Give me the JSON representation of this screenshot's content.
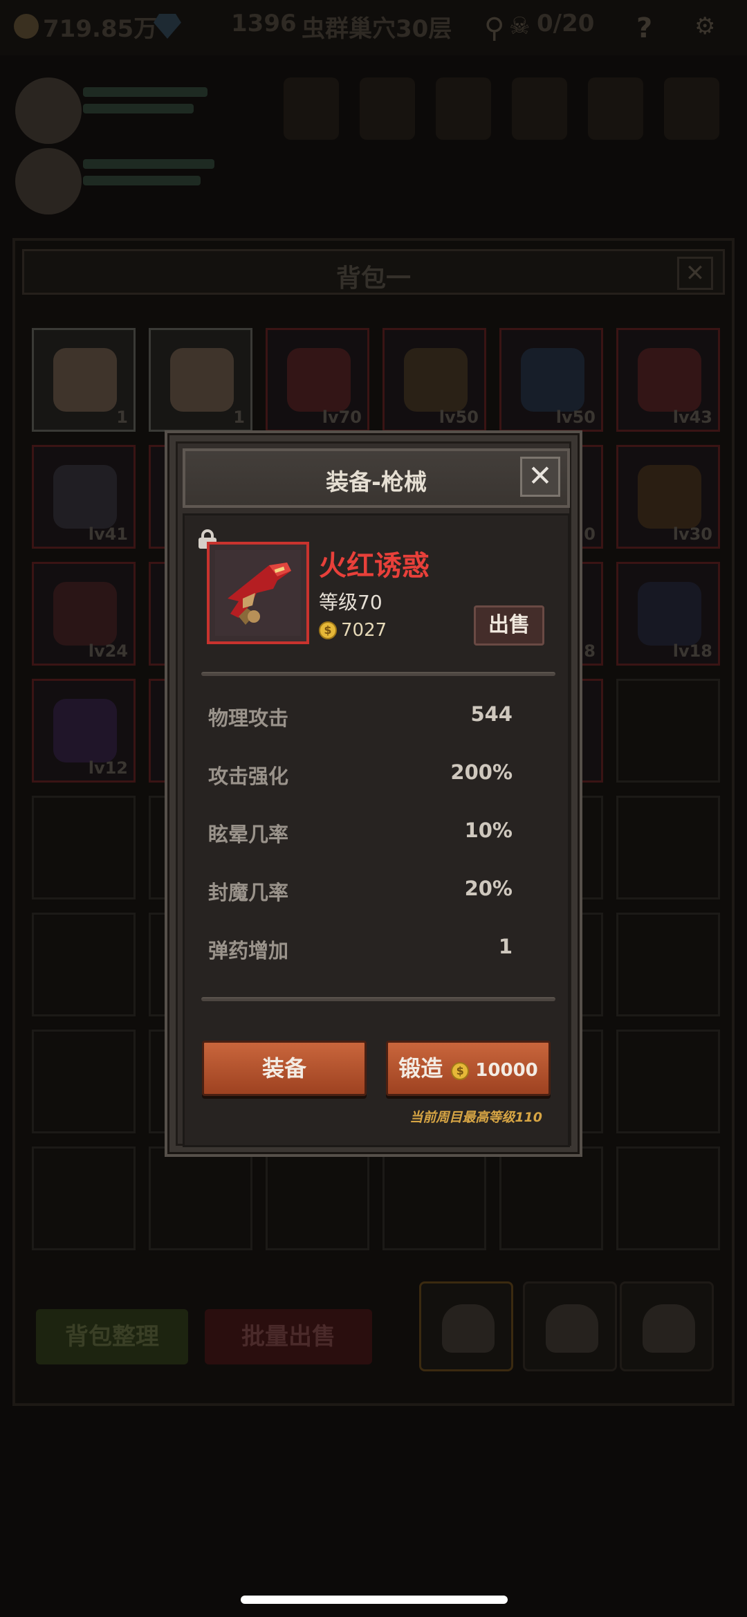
{
  "top_bar": {
    "gold": "719.85万",
    "score": "1396",
    "location": "虫群巢穴30层",
    "keys": "0/20",
    "help_icon": "?"
  },
  "background_panel": {
    "title": "背包一",
    "close_label": "✕",
    "grid_levels": [
      "1",
      "1",
      "lv70",
      "lv50",
      "lv50",
      "lv43",
      "lv41",
      "",
      "",
      "",
      "0",
      "lv30",
      "lv24",
      "",
      "",
      "",
      "8",
      "lv18",
      "lv12"
    ],
    "sort_button": "背包整理",
    "bulk_sell_button": "批量出售"
  },
  "modal": {
    "title": "装备-枪械",
    "close_label": "✕",
    "item": {
      "name": "火红诱惑",
      "level_text": "等级70",
      "coin_symbol": "$",
      "price": "7027",
      "locked": true
    },
    "sell_button": "出售",
    "stats": [
      {
        "label": "物理攻击",
        "value": "544"
      },
      {
        "label": "攻击强化",
        "value": "200%"
      },
      {
        "label": "眩晕几率",
        "value": "10%"
      },
      {
        "label": "封魔几率",
        "value": "20%"
      },
      {
        "label": "弹药增加",
        "value": "1"
      }
    ],
    "equip_button": "装备",
    "forge_button": "锻造",
    "forge_cost": "10000",
    "forge_note": "当前周目最高等级110"
  },
  "colors": {
    "item_name": "#e8403a",
    "item_border": "#c8332e",
    "button_orange": "#b5532e",
    "note_gold": "#d7a544"
  }
}
